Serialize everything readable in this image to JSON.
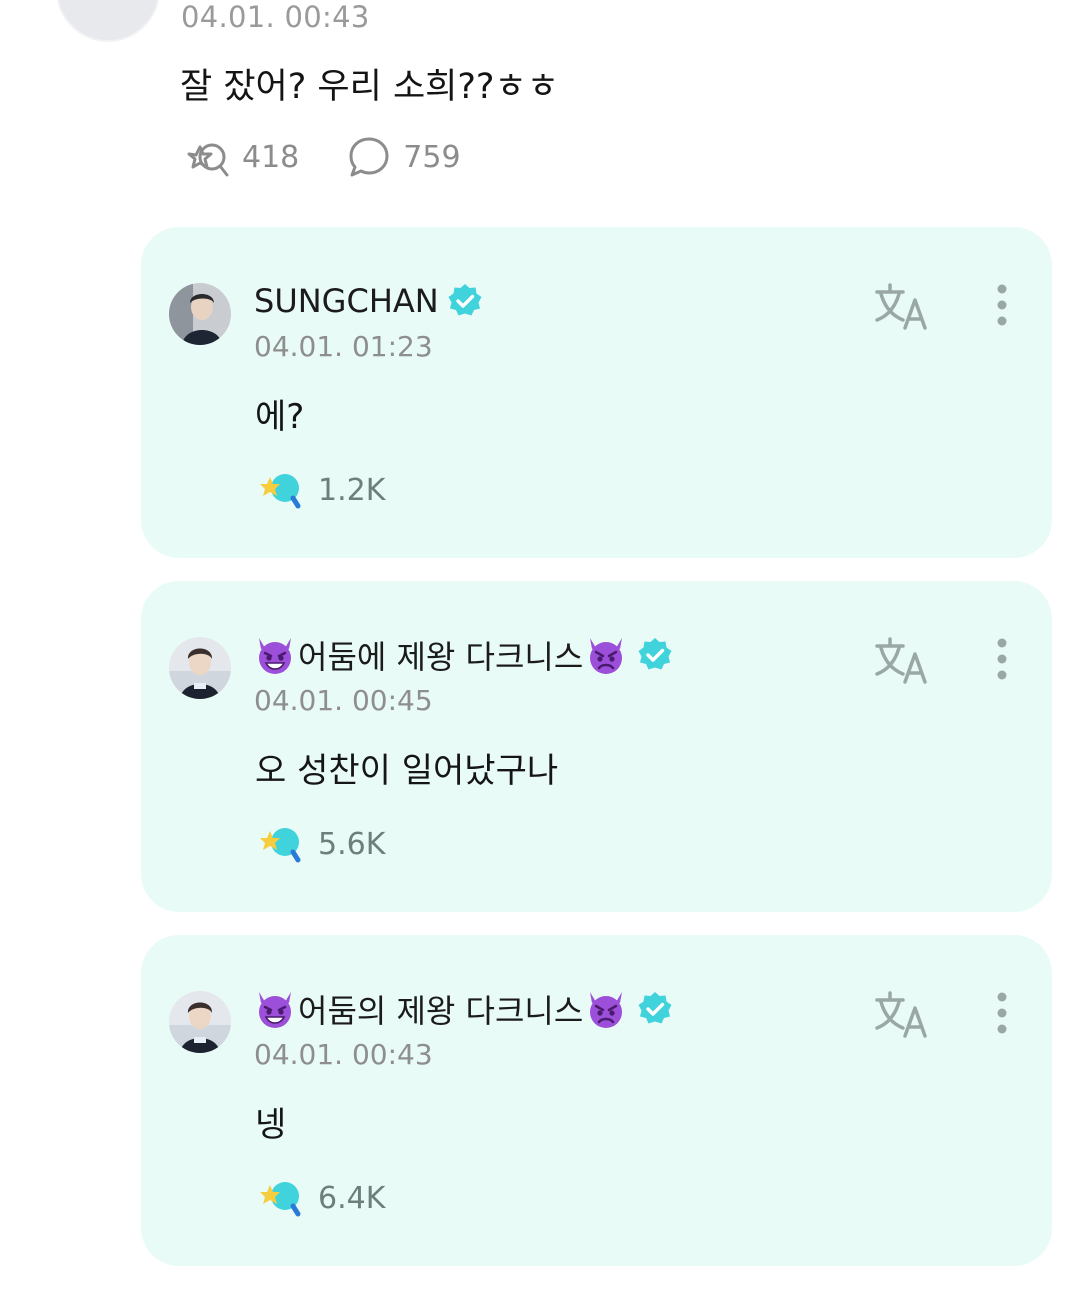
{
  "post": {
    "time": "04.01. 00:43",
    "text": "잘 잤어? 우리 소희??ㅎㅎ",
    "reaction_count": "418",
    "comment_count": "759"
  },
  "replies": [
    {
      "name": "SUNGCHAN",
      "time": "04.01. 01:23",
      "text": "에?",
      "likes": "1.2K"
    },
    {
      "name": "어둠에 제왕 다크니스",
      "time": "04.01. 00:45",
      "text": "오 성찬이 일어났구나",
      "likes": "5.6K"
    },
    {
      "name": "어둠의 제왕 다크니스",
      "time": "04.01. 00:43",
      "text": "넹",
      "likes": "6.4K"
    }
  ],
  "colors": {
    "card_background": "#e9fbf7",
    "verified_badge": "#41d3dc",
    "icon_gray": "#8a9a97"
  },
  "icons": {
    "reaction": "star-bubble-icon",
    "comment": "comment-icon",
    "translate": "translate-icon",
    "more": "more-vertical-icon",
    "verified": "verified-badge-icon",
    "emoji": "smiling-devil-emoji",
    "emoji_angry": "angry-devil-emoji"
  }
}
